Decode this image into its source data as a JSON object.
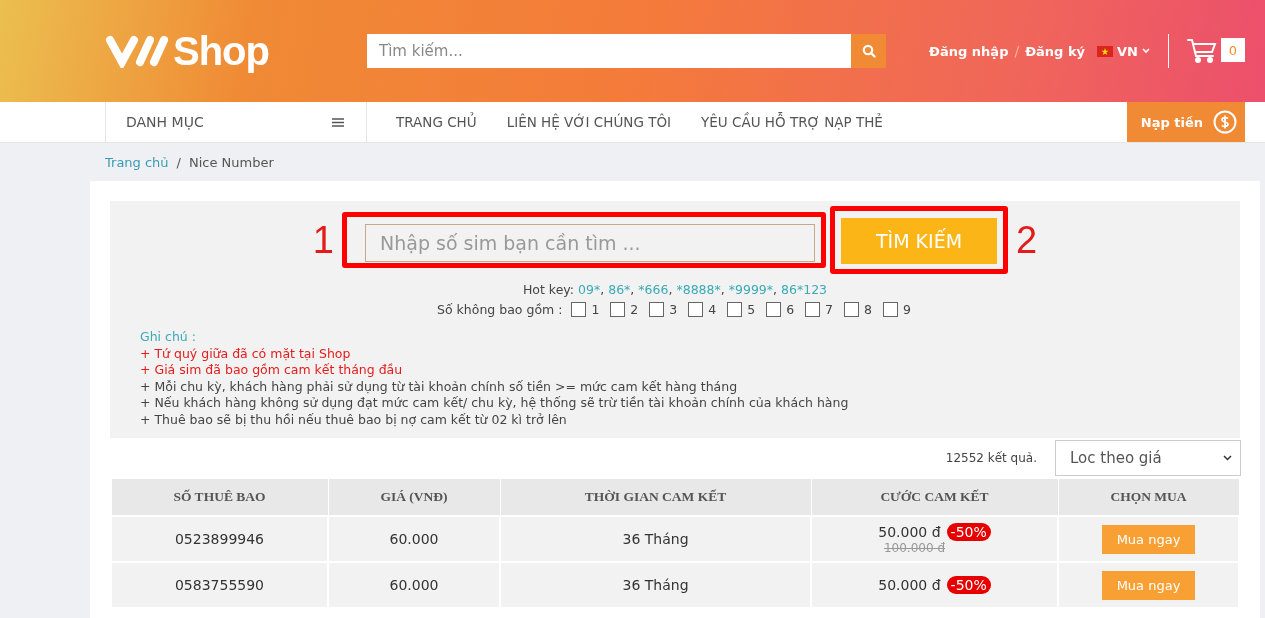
{
  "header": {
    "logo_text": "Shop",
    "search": {
      "placeholder": "Tìm kiếm..."
    },
    "login": "Đăng nhập",
    "separator": "/",
    "register": "Đăng ký",
    "language": "VN",
    "cart_count": "0"
  },
  "nav": {
    "category": "DANH MỤC",
    "links": [
      "TRANG CHỦ",
      "LIÊN HỆ VỚI CHÚNG TÔI",
      "YÊU CẦU HỖ TRỢ NẠP THẺ"
    ],
    "topup": "Nạp tiền"
  },
  "breadcrumb": {
    "items": [
      "Trang chủ",
      "Nice Number"
    ],
    "separator": "/"
  },
  "sim_search": {
    "placeholder": "Nhập số sim bạn cần tìm ...",
    "button": "TÌM KIẾM",
    "annotations": [
      "1",
      "2"
    ],
    "hot_key_label": "Hot key:",
    "hot_keys": [
      "09*",
      "86*",
      "*666",
      "*8888*",
      "*9999*",
      "86*123"
    ],
    "hot_key_separator": ",",
    "exclude_label": "Số không bao gồm :",
    "exclude_digits": [
      {
        "label": "1",
        "checked": false
      },
      {
        "label": "2",
        "checked": false
      },
      {
        "label": "3",
        "checked": false
      },
      {
        "label": "4",
        "checked": false
      },
      {
        "label": "5",
        "checked": false
      },
      {
        "label": "6",
        "checked": false
      },
      {
        "label": "7",
        "checked": false
      },
      {
        "label": "8",
        "checked": false
      },
      {
        "label": "9",
        "checked": false
      }
    ],
    "notes_title": "Ghi chú :",
    "notes": [
      {
        "text": "+ Tứ quý giữa đã có mặt tại Shop",
        "highlight": true
      },
      {
        "text": "+ Giá sim đã bao gồm cam kết tháng đầu",
        "highlight": true
      },
      {
        "text": "+ Mỗi chu kỳ, khách hàng phải sử dụng từ tài khoản chính số tiền >= mức cam kết hàng tháng",
        "highlight": false
      },
      {
        "text": "+ Nếu khách hàng không sử dụng đạt mức cam kết/ chu kỳ, hệ thống sẽ trừ tiền tài khoản chính của khách hàng",
        "highlight": false
      },
      {
        "text": "+ Thuê bao sẽ bị thu hồi nếu thuê bao bị nợ cam kết từ 02 kì trở lên",
        "highlight": false
      }
    ]
  },
  "results": {
    "count": "12552 kết quả.",
    "sort": {
      "value": "Loc theo giá"
    }
  },
  "table": {
    "columns": [
      "SỐ THUÊ BAO",
      "GIÁ (VNĐ)",
      "THỜI GIAN CAM KẾT",
      "CƯỚC CAM KẾT",
      "CHỌN MUA"
    ],
    "rows": [
      {
        "number": "0523899946",
        "price": "60.000",
        "term": "36 Tháng",
        "fee": "50.000 đ",
        "discount": "-50%",
        "old_fee": "100.000 đ",
        "action": "Mua ngay"
      },
      {
        "number": "0583755590",
        "price": "60.000",
        "term": "36 Tháng",
        "fee": "50.000 đ",
        "discount": "-50%",
        "action": "Mua ngay"
      }
    ]
  }
}
